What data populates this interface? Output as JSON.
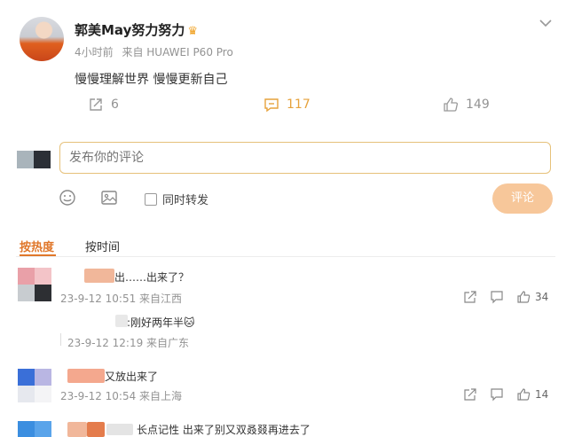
{
  "post": {
    "username": "郭美May努力努力",
    "crown_icon": "crown-icon",
    "time": "4小时前",
    "source": "来自 HUAWEI P60 Pro",
    "text": "慢慢理解世界 慢慢更新自己",
    "repost_count": "6",
    "comment_count": "117",
    "like_count": "149"
  },
  "composer": {
    "placeholder": "发布你的评论",
    "repost_label": "同时转发",
    "submit_label": "评论"
  },
  "sort": {
    "hot_label": "按热度",
    "time_label": "按时间"
  },
  "comments": [
    {
      "text": "出……出来了？",
      "meta": "23-9-12 10:51 来自江西",
      "like_count": "34"
    },
    {
      "text": ":刚好两年半🐱",
      "meta": "23-9-12 12:19 来自广东"
    },
    {
      "text": "又放出来了",
      "meta": "23-9-12 10:54 来自上海",
      "like_count": "14"
    },
    {
      "text": "长点记性 出来了别又双叒叕再进去了"
    }
  ],
  "colors": {
    "accent": "#e0772a",
    "comment_count": "#e6a23c",
    "submit_disabled": "#f7c79a",
    "input_border": "#e6c17a"
  }
}
